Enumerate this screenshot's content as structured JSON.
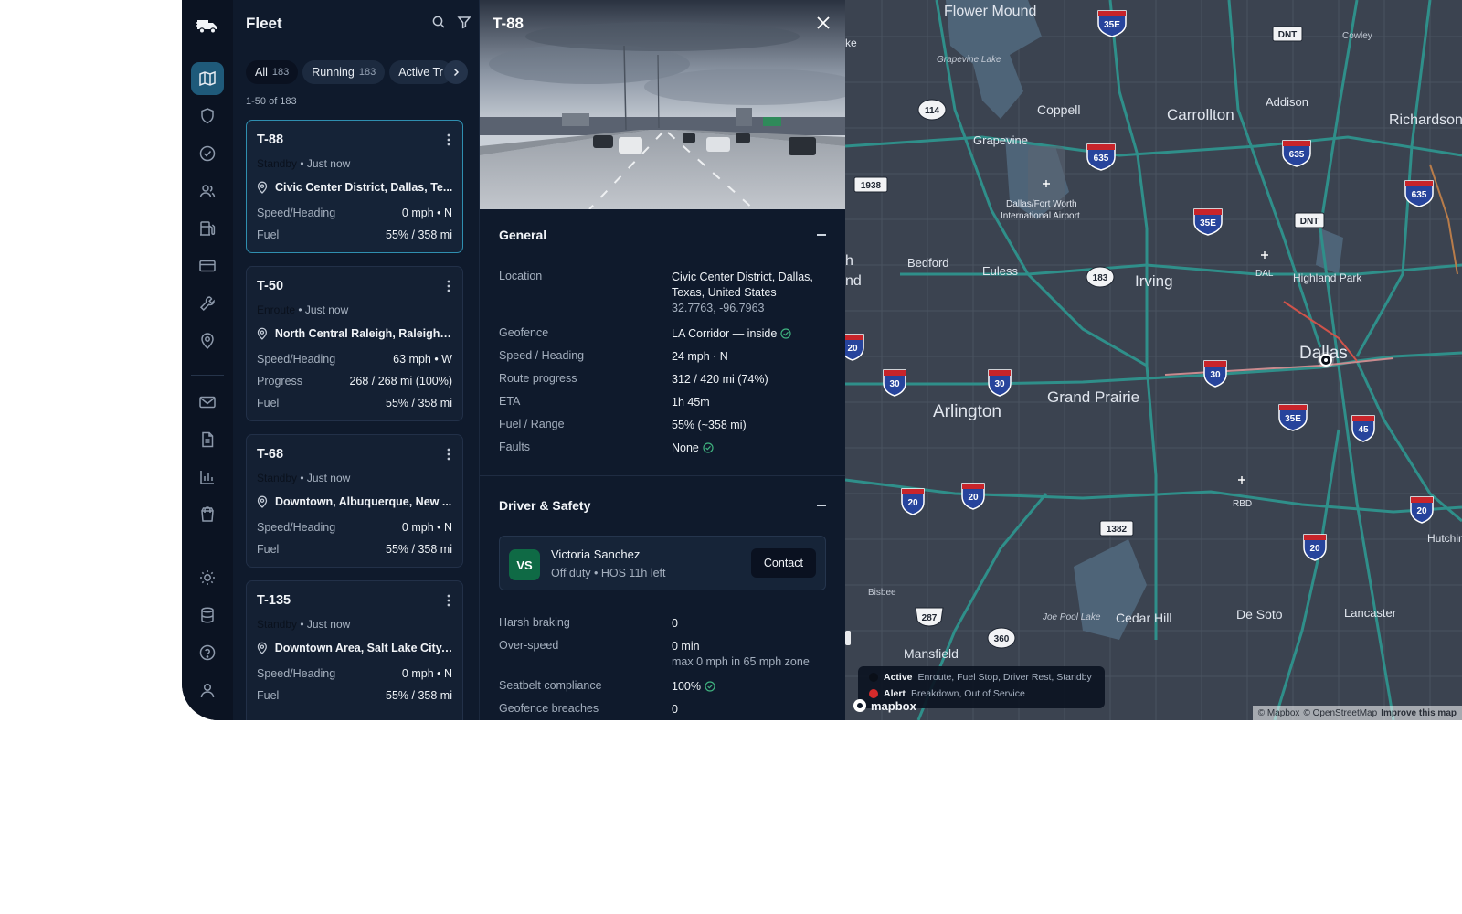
{
  "rail": {
    "items": [
      "map",
      "shield",
      "check-circle",
      "users",
      "fuel-pump",
      "credit-card",
      "wrench",
      "location-pin",
      "mail",
      "document",
      "bar-chart",
      "shopping-bag",
      "sun",
      "database",
      "help",
      "user"
    ],
    "active": "map"
  },
  "fleet": {
    "title": "Fleet",
    "chips": [
      {
        "label": "All",
        "count": "183"
      },
      {
        "label": "Running",
        "count": "183"
      },
      {
        "label": "Active Tr",
        "count": ""
      }
    ],
    "range": "1-50 of 183",
    "vehicles": [
      {
        "id": "T-88",
        "status": "Standby",
        "time": "• Just now",
        "location": "Civic Center District, Dallas, Te...",
        "rows": [
          {
            "k": "Speed/Heading",
            "v": "0 mph • N"
          },
          {
            "k": "Fuel",
            "v": "55% / 358 mi"
          }
        ]
      },
      {
        "id": "T-50",
        "status": "Enroute",
        "time": "• Just now",
        "location": "North Central Raleigh, Raleigh, ...",
        "rows": [
          {
            "k": "Speed/Heading",
            "v": "63 mph • W"
          },
          {
            "k": "Progress",
            "v": "268 / 268 mi (100%)"
          },
          {
            "k": "Fuel",
            "v": "55% / 358 mi"
          }
        ]
      },
      {
        "id": "T-68",
        "status": "Standby",
        "time": "• Just now",
        "location": "Downtown, Albuquerque, New ...",
        "rows": [
          {
            "k": "Speed/Heading",
            "v": "0 mph • N"
          },
          {
            "k": "Fuel",
            "v": "55% / 358 mi"
          }
        ]
      },
      {
        "id": "T-135",
        "status": "Standby",
        "time": "• Just now",
        "location": "Downtown Area, Salt Lake City, ...",
        "rows": [
          {
            "k": "Speed/Heading",
            "v": "0 mph • N"
          },
          {
            "k": "Fuel",
            "v": "55% / 358 mi"
          }
        ]
      }
    ]
  },
  "detail": {
    "title": "T-88",
    "general": {
      "title": "General",
      "location_k": "Location",
      "location_v": "Civic Center District, Dallas, Texas, United States",
      "location_coords": "32.7763, -96.7963",
      "rows": [
        {
          "k": "Geofence",
          "v": "LA Corridor — inside"
        },
        {
          "k": "Speed / Heading",
          "v": "24 mph · N"
        },
        {
          "k": "Route progress",
          "v": "312 / 420 mi (74%)"
        },
        {
          "k": "ETA",
          "v": "1h 45m"
        },
        {
          "k": "Fuel / Range",
          "v": "55% (~358 mi)"
        },
        {
          "k": "Faults",
          "v": "None"
        }
      ]
    },
    "driver": {
      "title": "Driver & Safety",
      "initials": "VS",
      "name": "Victoria Sanchez",
      "sub": "Off duty • HOS 11h left",
      "contact": "Contact",
      "harsh_k": "Harsh braking",
      "harsh_v": "0",
      "overspeed_k": "Over-speed",
      "overspeed_v": "0 min",
      "overspeed_sub": "max 0 mph in 65 mph zone",
      "seatbelt_k": "Seatbelt compliance",
      "seatbelt_v": "100%",
      "geobreach_k": "Geofence breaches",
      "geobreach_v": "0"
    }
  },
  "map": {
    "places": [
      "Flower Mound",
      "Grapevine Lake",
      "Coppell",
      "Carrollton",
      "Addison",
      "Richardson",
      "Grapevine",
      "Dallas/Fort Worth",
      "International Airport",
      "Bedford",
      "Euless",
      "Irving",
      "DAL",
      "Highland Park",
      "Dallas",
      "Arlington",
      "Grand Prairie",
      "RBD",
      "Bisbee",
      "Joe Pool Lake",
      "Cedar Hill",
      "De Soto",
      "Lancaster",
      "Mansfield",
      "Hutchin",
      "Cowley",
      "ke",
      "h",
      "nd"
    ],
    "shields": [
      "35E",
      "635",
      "635",
      "635",
      "35E",
      "35E",
      "30",
      "30",
      "30",
      "20",
      "20",
      "20",
      "20",
      "20",
      "45",
      "20"
    ],
    "route_signs": [
      "114",
      "183",
      "1938",
      "287",
      "360",
      "1382",
      "DNT",
      "DNT"
    ],
    "legend": {
      "active_label": "Active",
      "active_desc": "Enroute, Fuel Stop, Driver Rest, Standby",
      "alert_label": "Alert",
      "alert_desc": "Breakdown, Out of Service",
      "active_color": "#0a0f18",
      "alert_color": "#d62b2b"
    },
    "brand": "mapbox",
    "attribution": [
      "© Mapbox",
      "© OpenStreetMap",
      "Improve this map"
    ]
  }
}
